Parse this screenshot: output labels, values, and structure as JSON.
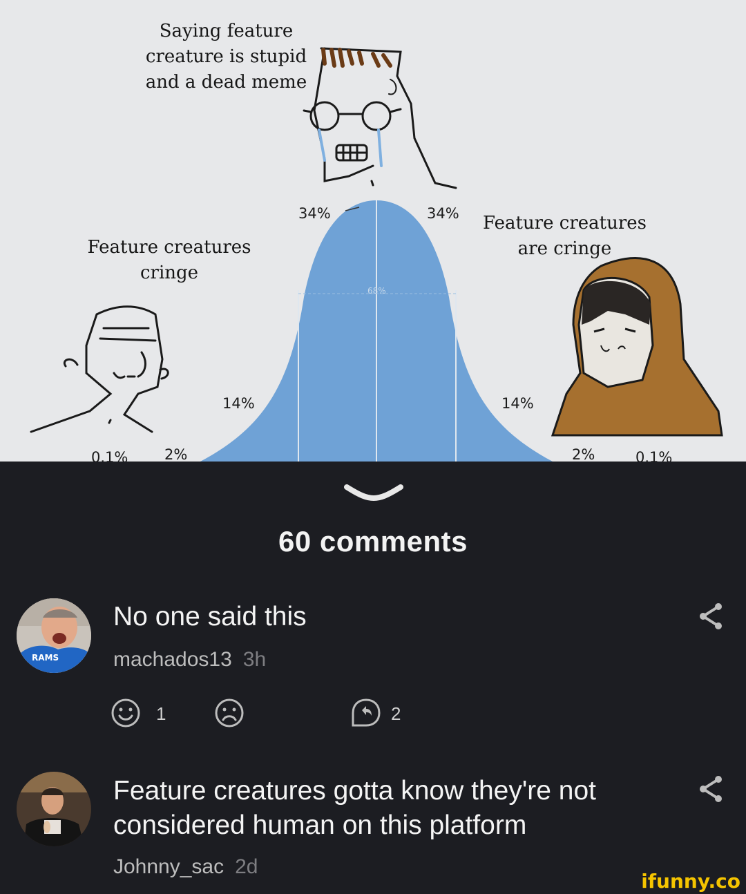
{
  "meme": {
    "top_caption": [
      "Saying feature",
      "creature is stupid",
      "and a dead meme"
    ],
    "left_caption": [
      "Feature creatures",
      "cringe"
    ],
    "right_caption": [
      "Feature creatures",
      "are cringe"
    ],
    "percentages": {
      "center_left": "34%",
      "center_right": "34%",
      "inner_left": "14%",
      "inner_right": "14%",
      "outer_left": "2%",
      "outer_right": "2%",
      "far_left": "0.1%",
      "far_right": "0.1%",
      "center_label": "68%"
    }
  },
  "comments_header": "60 comments",
  "comments": [
    {
      "text": "No one said this",
      "username": "machados13",
      "time": "3h",
      "likes": "1",
      "replies": "2"
    },
    {
      "text_lines": [
        "Feature creatures gotta know they're not",
        "considered human on this platform"
      ],
      "username": "Johnny_sac",
      "time": "2d"
    }
  ],
  "watermark": "ifunny.co",
  "icons": [
    "chevron-down-icon",
    "smile-icon",
    "frown-icon",
    "reply-icon",
    "share-icon"
  ],
  "colors": {
    "background": "#1c1d22",
    "curve": "#6fa2d6",
    "watermark": "#f5c400"
  }
}
